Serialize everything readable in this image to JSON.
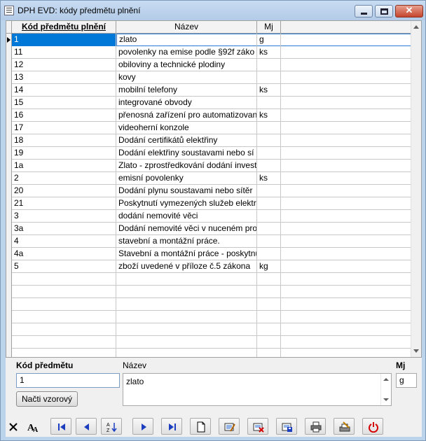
{
  "window": {
    "title": "DPH EVD: kódy předmětu plnění"
  },
  "grid": {
    "columns": [
      "Kód předmětu plnění",
      "Název",
      "Mj"
    ],
    "rows": [
      {
        "code": "1",
        "name": "zlato",
        "unit": "g",
        "selected": true
      },
      {
        "code": "11",
        "name": "povolenky na emise podle §92f záko",
        "unit": "ks"
      },
      {
        "code": "12",
        "name": "obiloviny a technické plodiny",
        "unit": ""
      },
      {
        "code": "13",
        "name": "kovy",
        "unit": ""
      },
      {
        "code": "14",
        "name": "mobilní telefony",
        "unit": "ks"
      },
      {
        "code": "15",
        "name": "integrované obvody",
        "unit": ""
      },
      {
        "code": "16",
        "name": "přenosná zařízení pro automatizovan",
        "unit": "ks"
      },
      {
        "code": "17",
        "name": "videoherní konzole",
        "unit": ""
      },
      {
        "code": "18",
        "name": "Dodání certifikátů elektřiny",
        "unit": ""
      },
      {
        "code": "19",
        "name": "Dodání elektřiny soustavami nebo sí",
        "unit": ""
      },
      {
        "code": "1a",
        "name": "Zlato - zprostředkování dodání invest",
        "unit": ""
      },
      {
        "code": "2",
        "name": "emisní povolenky",
        "unit": "ks"
      },
      {
        "code": "20",
        "name": "Dodání plynu soustavami nebo sítěr",
        "unit": ""
      },
      {
        "code": "21",
        "name": "Poskytnutí vymezených služeb elektro",
        "unit": ""
      },
      {
        "code": "3",
        "name": "dodání nemovité věci",
        "unit": ""
      },
      {
        "code": "3a",
        "name": "Dodání nemovité věci v nuceném pro",
        "unit": ""
      },
      {
        "code": "4",
        "name": "stavební a montážní práce.",
        "unit": ""
      },
      {
        "code": "4a",
        "name": "Stavební a montážní práce - poskytnu",
        "unit": ""
      },
      {
        "code": "5",
        "name": "zboží uvedené v příloze č.5 zákona",
        "unit": "kg"
      }
    ],
    "empty_rows": 7
  },
  "detail": {
    "code_label": "Kód předmětu",
    "code_value": "1",
    "name_label": "Název",
    "name_value": "zlato",
    "unit_label": "Mj",
    "unit_value": "g",
    "load_button": "Načti vzorový"
  },
  "toolbar": {
    "buttons": [
      "close-icon",
      "font-icon",
      "first-record-icon",
      "previous-record-icon",
      "sort-az-icon",
      "next-record-icon",
      "last-record-icon",
      "new-record-icon",
      "edit-record-icon",
      "delete-record-icon",
      "save-record-icon",
      "print-icon",
      "print-setup-icon",
      "power-icon"
    ]
  }
}
